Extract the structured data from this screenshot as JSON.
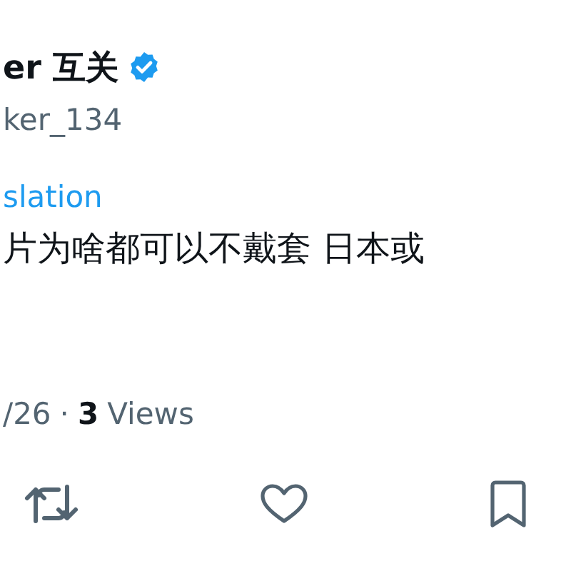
{
  "author": {
    "display_name": "er 互关",
    "verified": true,
    "handle": "ker_134"
  },
  "translation_link": "slation",
  "text": "片为啥都可以不戴套 日本或",
  "meta": {
    "date": "/26",
    "separator": "·",
    "views_count": "3",
    "views_label": "Views"
  }
}
